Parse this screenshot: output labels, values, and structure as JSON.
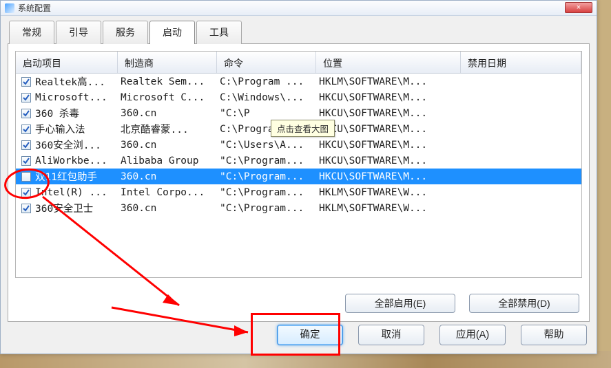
{
  "window": {
    "title": "系统配置",
    "close_label": "×"
  },
  "tabs": {
    "general": "常规",
    "boot": "引导",
    "services": "服务",
    "startup": "启动",
    "tools": "工具"
  },
  "columns": {
    "item": "启动项目",
    "mfr": "制造商",
    "cmd": "命令",
    "loc": "位置",
    "date": "禁用日期"
  },
  "rows": [
    {
      "checked": true,
      "item": "Realtek高...",
      "mfr": "Realtek Sem...",
      "cmd": "C:\\Program ...",
      "loc": "HKLM\\SOFTWARE\\M..."
    },
    {
      "checked": true,
      "item": "Microsoft...",
      "mfr": "Microsoft C...",
      "cmd": "C:\\Windows\\...",
      "loc": "HKCU\\SOFTWARE\\M..."
    },
    {
      "checked": true,
      "item": "360 杀毒",
      "mfr": "360.cn",
      "cmd": "\"C:\\P",
      "loc": "HKCU\\SOFTWARE\\M..."
    },
    {
      "checked": true,
      "item": "手心输入法",
      "mfr": "北京酷睿蒙...",
      "cmd": "C:\\Program...",
      "loc": "HKCU\\SOFTWARE\\M..."
    },
    {
      "checked": true,
      "item": "360安全浏...",
      "mfr": "360.cn",
      "cmd": "\"C:\\Users\\A...",
      "loc": "HKCU\\SOFTWARE\\M..."
    },
    {
      "checked": true,
      "item": "AliWorkbe...",
      "mfr": "Alibaba Group",
      "cmd": "\"C:\\Program...",
      "loc": "HKCU\\SOFTWARE\\M..."
    },
    {
      "checked": false,
      "item": "双11红包助手",
      "mfr": "360.cn",
      "cmd": "\"C:\\Program...",
      "loc": "HKCU\\SOFTWARE\\M...",
      "selected": true
    },
    {
      "checked": true,
      "item": "Intel(R) ...",
      "mfr": "Intel Corpo...",
      "cmd": "\"C:\\Program...",
      "loc": "HKLM\\SOFTWARE\\W..."
    },
    {
      "checked": true,
      "item": "360安全卫士",
      "mfr": "360.cn",
      "cmd": "\"C:\\Program...",
      "loc": "HKLM\\SOFTWARE\\W..."
    }
  ],
  "tooltip": "点击查看大图",
  "inner_buttons": {
    "enable_all": "全部启用(E)",
    "disable_all": "全部禁用(D)"
  },
  "dlg_buttons": {
    "ok": "确定",
    "cancel": "取消",
    "apply": "应用(A)",
    "help": "帮助"
  }
}
